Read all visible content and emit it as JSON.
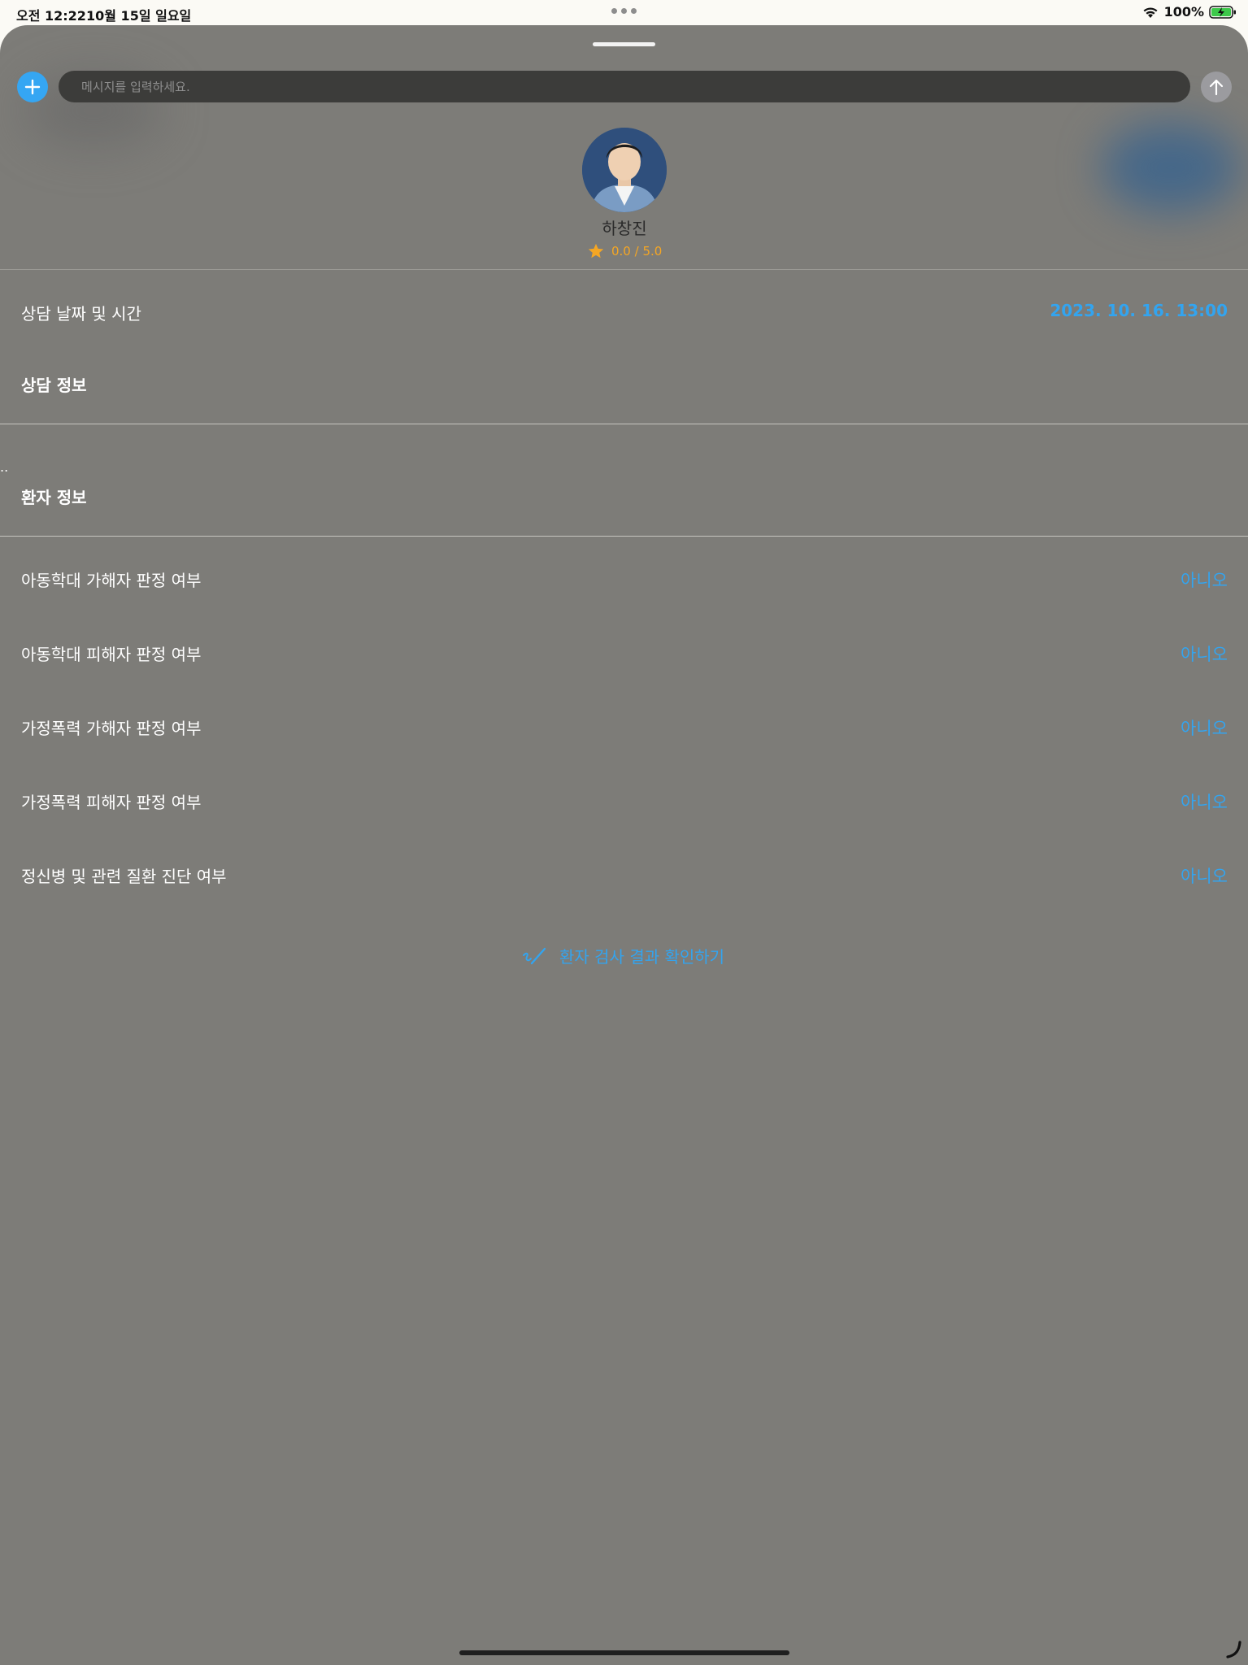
{
  "status_bar": {
    "time": "오전 12:22",
    "date": "10월 15일 일요일",
    "battery": "100%"
  },
  "composer": {
    "placeholder": "메시지를 입력하세요."
  },
  "profile": {
    "name": "하창진",
    "rating": "0.0 / 5.0"
  },
  "consult": {
    "datetime_label": "상담 날짜 및 시간",
    "datetime_value": "2023. 10. 16. 13:00",
    "info_header": "상담 정보",
    "stray_text": ".."
  },
  "patient": {
    "header": "환자 정보",
    "rows": [
      {
        "label": "아동학대 가해자 판정 여부",
        "value": "아니오"
      },
      {
        "label": "아동학대 피해자 판정 여부",
        "value": "아니오"
      },
      {
        "label": "가정폭력 가해자 판정 여부",
        "value": "아니오"
      },
      {
        "label": "가정폭력 피해자 판정 여부",
        "value": "아니오"
      },
      {
        "label": "정신병 및 관련 질환 진단 여부",
        "value": "아니오"
      }
    ],
    "result_link": "환자 검사 결과 확인하기"
  },
  "colors": {
    "accent": "#33a4ef",
    "sheet": "#7d7c78",
    "star": "#f5a623"
  }
}
